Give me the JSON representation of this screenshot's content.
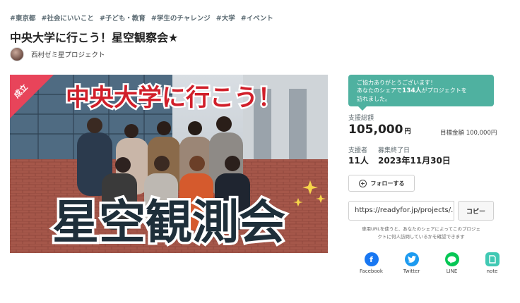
{
  "tags": [
    "#東京都",
    "#社会にいいこと",
    "#子ども・教育",
    "#学生のチャレンジ",
    "#大学",
    "#イベント"
  ],
  "project": {
    "title": "中央大学に行こう！星空観察会★",
    "owner": "西村ゼミ星プロジェクト"
  },
  "hero": {
    "badge": "成立",
    "headline": "中央大学に行こう！",
    "big_text": "星空観測会"
  },
  "cheer": {
    "line1": "ご協力ありがとうございます！",
    "line2_prefix": "あなたのシェアで",
    "count": "134人",
    "line2_suffix": "がプロジェクトを",
    "line3": "訪れました。"
  },
  "stats": {
    "total_label": "支援総額",
    "total_amount": "105,000",
    "total_unit": "円",
    "goal": "目標金額 100,000円",
    "supporters_label": "支援者",
    "supporters": "11人",
    "end_label": "募集終了日",
    "end_date": "2023年11月30日"
  },
  "follow": {
    "label": "フォローする"
  },
  "share": {
    "url": "https://readyfor.jp/projects/...",
    "copy_label": "コピー",
    "note_line1": "専用URLを使うと、あなたのシェアによってこのプロジェ",
    "note_line2": "クトに何人訪問しているかを確認できます"
  },
  "socials": [
    {
      "name": "Facebook",
      "icon": "facebook-icon",
      "color": "#1877f2"
    },
    {
      "name": "Twitter",
      "icon": "twitter-icon",
      "color": "#1d9bf0"
    },
    {
      "name": "LINE",
      "icon": "line-icon",
      "color": "#06c755"
    },
    {
      "name": "note",
      "icon": "note-icon",
      "color": "#41c9b4"
    }
  ]
}
